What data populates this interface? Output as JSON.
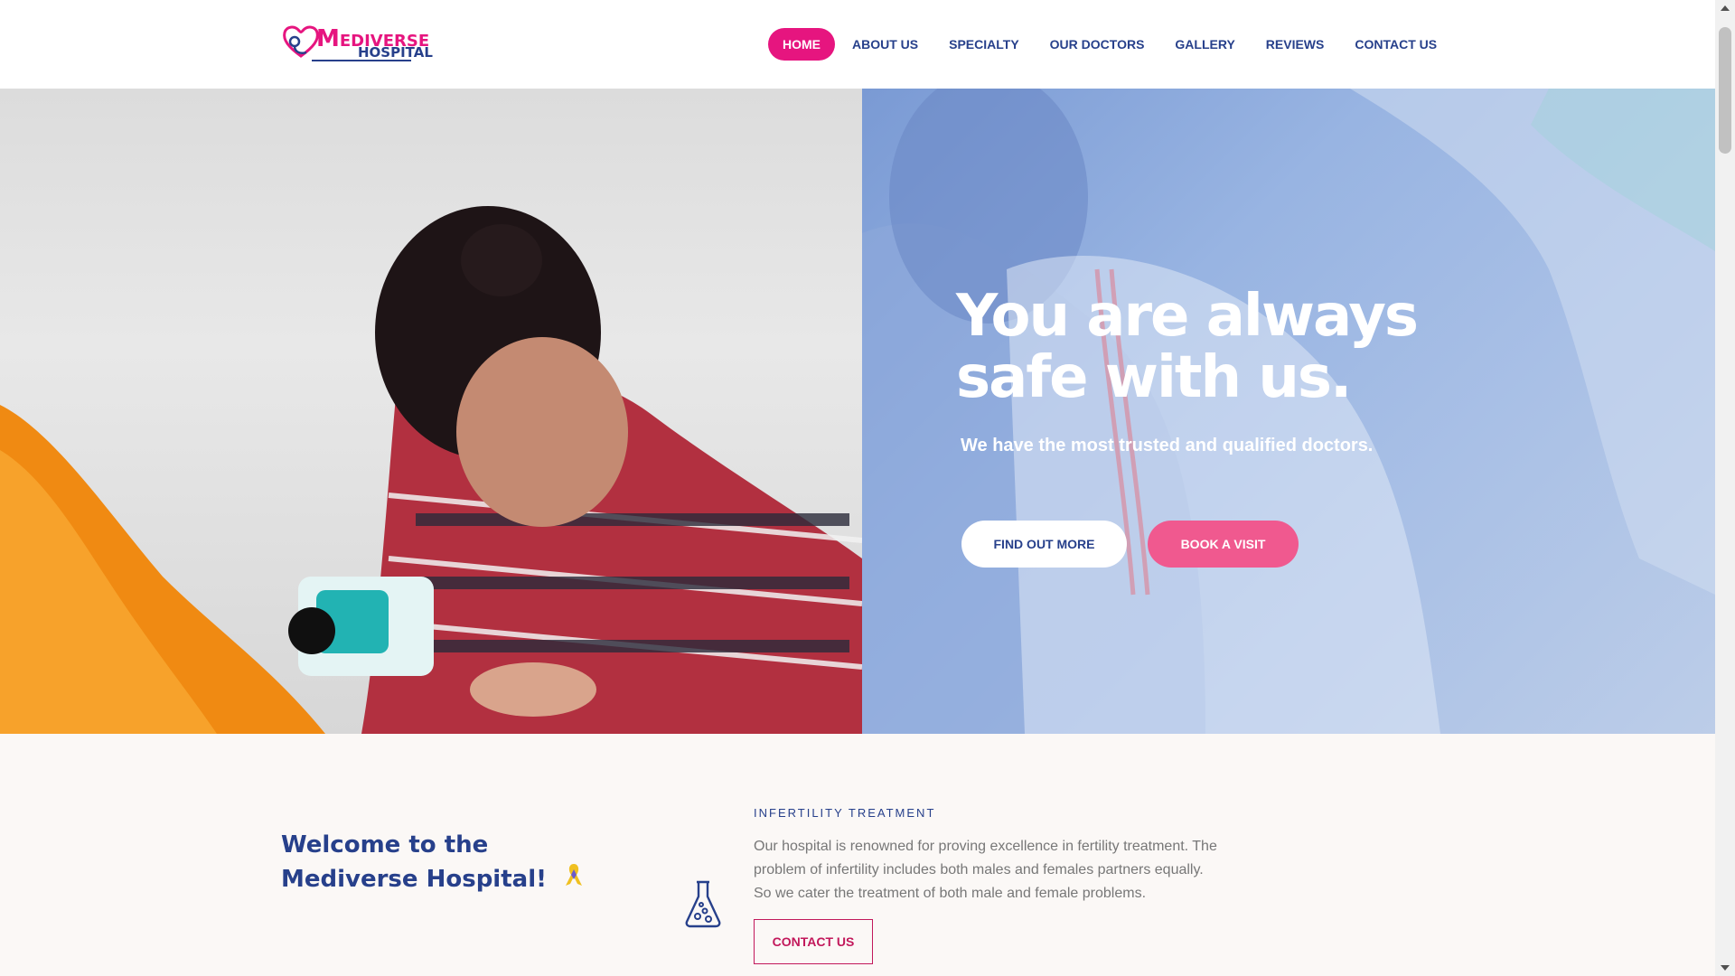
{
  "header": {
    "logo": {
      "word1": "Mediverse",
      "word2": "HOSPITAL"
    },
    "nav": [
      {
        "label": "HOME",
        "active": true
      },
      {
        "label": "ABOUT US"
      },
      {
        "label": "SPECIALTY"
      },
      {
        "label": "OUR DOCTORS"
      },
      {
        "label": "GALLERY"
      },
      {
        "label": "REVIEWS"
      },
      {
        "label": "CONTACT US"
      }
    ]
  },
  "hero": {
    "title_line1": "You are always",
    "title_line2": "safe with us.",
    "subtitle": "We have the most trusted and qualified doctors.",
    "find_out_more": "FIND OUT MORE",
    "book_visit": "BOOK A VISIT",
    "left_image": "doctor-examining-patient-photo",
    "right_image": "doctors-with-patient-photo"
  },
  "welcome": {
    "title": "Welcome to the Mediverse Hospital!",
    "emoji": "ribbon-icon"
  },
  "feature": {
    "icon": "flask-icon",
    "eyebrow": "INFERTILITY TREATMENT",
    "text": "Our hospital is renowned for proving excellence in fertility treatment. The problem of infertility includes both males and females partners equally. So we cater the treatment of both male and female problems.",
    "button": "CONTACT US"
  },
  "colors": {
    "brand_pink": "#e6157f",
    "brand_navy": "#27408b",
    "button_pink": "#f0598f"
  }
}
